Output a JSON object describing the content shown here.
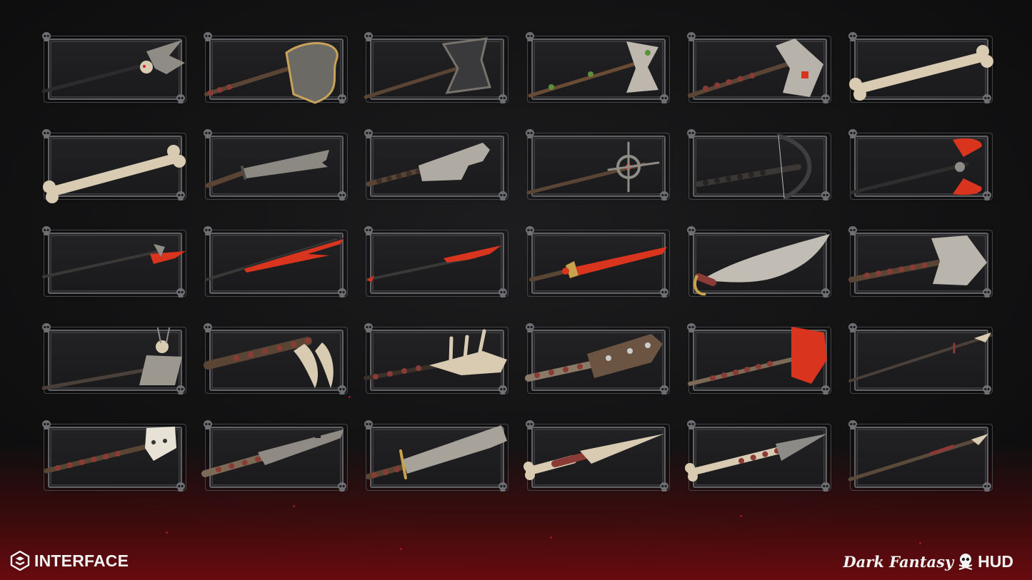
{
  "branding": {
    "left_label": "INTERFACE",
    "right_title": "Dark Fantasy",
    "right_suffix": "HUD"
  },
  "colors": {
    "frame": "#5f6165",
    "slot_bg": "#1e1e20",
    "accent_red": "#d9341e",
    "bone": "#d8cbb2",
    "metal": "#8f8c86",
    "wood": "#5a4535",
    "wrap": "#8a3b35"
  },
  "inventory": {
    "rows": 5,
    "columns": 6,
    "slots": [
      {
        "icon": "skull-halberd-icon"
      },
      {
        "icon": "bronze-battle-axe-icon"
      },
      {
        "icon": "dark-double-axe-icon"
      },
      {
        "icon": "vine-wrapped-axe-icon"
      },
      {
        "icon": "bone-cleaver-axe-icon"
      },
      {
        "icon": "femur-bone-club-icon"
      },
      {
        "icon": "large-bone-club-icon"
      },
      {
        "icon": "jagged-stone-sword-icon"
      },
      {
        "icon": "broken-cleaver-blade-icon"
      },
      {
        "icon": "crosshair-mace-staff-icon"
      },
      {
        "icon": "recurve-crossbow-icon"
      },
      {
        "icon": "red-double-axe-icon"
      },
      {
        "icon": "long-halberd-spear-icon"
      },
      {
        "icon": "red-trident-spear-icon"
      },
      {
        "icon": "red-hooked-spear-icon"
      },
      {
        "icon": "crimson-longsword-icon"
      },
      {
        "icon": "curved-scimitar-icon"
      },
      {
        "icon": "bone-hammer-icon"
      },
      {
        "icon": "skull-totem-axe-icon"
      },
      {
        "icon": "tusk-claw-club-icon"
      },
      {
        "icon": "ribcage-club-icon"
      },
      {
        "icon": "studded-war-club-icon"
      },
      {
        "icon": "red-shield-hammer-icon"
      },
      {
        "icon": "thin-bone-spear-icon"
      },
      {
        "icon": "skull-mace-icon"
      },
      {
        "icon": "notched-machete-icon"
      },
      {
        "icon": "wide-falchion-icon"
      },
      {
        "icon": "bone-dagger-icon"
      },
      {
        "icon": "bone-tipped-spear-icon"
      },
      {
        "icon": "wooden-spear-icon"
      }
    ]
  }
}
